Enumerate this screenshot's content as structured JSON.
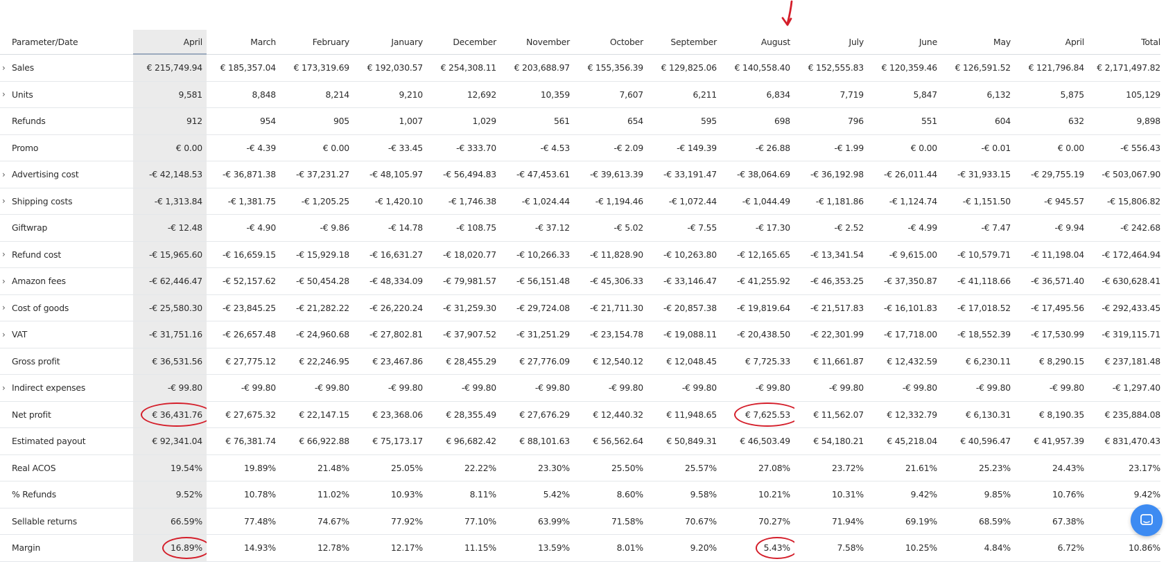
{
  "table": {
    "param_header": "Parameter/Date",
    "columns": [
      "April",
      "March",
      "February",
      "January",
      "December",
      "November",
      "October",
      "September",
      "August",
      "July",
      "June",
      "May",
      "April",
      "Total"
    ],
    "selected_column_index": 0,
    "rows": [
      {
        "label": "Sales",
        "expandable": true,
        "values": [
          "€ 215,749.94",
          "€ 185,357.04",
          "€ 173,319.69",
          "€ 192,030.57",
          "€ 254,308.11",
          "€ 203,688.97",
          "€ 155,356.39",
          "€ 129,825.06",
          "€ 140,558.40",
          "€ 152,555.83",
          "€ 120,359.46",
          "€ 126,591.52",
          "€ 121,796.84",
          "€ 2,171,497.82"
        ]
      },
      {
        "label": "Units",
        "expandable": true,
        "values": [
          "9,581",
          "8,848",
          "8,214",
          "9,210",
          "12,692",
          "10,359",
          "7,607",
          "6,211",
          "6,834",
          "7,719",
          "5,847",
          "6,132",
          "5,875",
          "105,129"
        ]
      },
      {
        "label": "Refunds",
        "expandable": false,
        "values": [
          "912",
          "954",
          "905",
          "1,007",
          "1,029",
          "561",
          "654",
          "595",
          "698",
          "796",
          "551",
          "604",
          "632",
          "9,898"
        ]
      },
      {
        "label": "Promo",
        "expandable": false,
        "values": [
          "€ 0.00",
          "-€ 4.39",
          "€ 0.00",
          "-€ 33.45",
          "-€ 333.70",
          "-€ 4.53",
          "-€ 2.09",
          "-€ 149.39",
          "-€ 26.88",
          "-€ 1.99",
          "€ 0.00",
          "-€ 0.01",
          "€ 0.00",
          "-€ 556.43"
        ]
      },
      {
        "label": "Advertising cost",
        "expandable": true,
        "values": [
          "-€ 42,148.53",
          "-€ 36,871.38",
          "-€ 37,231.27",
          "-€ 48,105.97",
          "-€ 56,494.83",
          "-€ 47,453.61",
          "-€ 39,613.39",
          "-€ 33,191.47",
          "-€ 38,064.69",
          "-€ 36,192.98",
          "-€ 26,011.44",
          "-€ 31,933.15",
          "-€ 29,755.19",
          "-€ 503,067.90"
        ]
      },
      {
        "label": "Shipping costs",
        "expandable": true,
        "values": [
          "-€ 1,313.84",
          "-€ 1,381.75",
          "-€ 1,205.25",
          "-€ 1,420.10",
          "-€ 1,746.38",
          "-€ 1,024.44",
          "-€ 1,194.46",
          "-€ 1,072.44",
          "-€ 1,044.49",
          "-€ 1,181.86",
          "-€ 1,124.74",
          "-€ 1,151.50",
          "-€ 945.57",
          "-€ 15,806.82"
        ]
      },
      {
        "label": "Giftwrap",
        "expandable": false,
        "values": [
          "-€ 12.48",
          "-€ 4.90",
          "-€ 9.86",
          "-€ 14.78",
          "-€ 108.75",
          "-€ 37.12",
          "-€ 5.02",
          "-€ 7.55",
          "-€ 17.30",
          "-€ 2.52",
          "-€ 4.99",
          "-€ 7.47",
          "-€ 9.94",
          "-€ 242.68"
        ]
      },
      {
        "label": "Refund cost",
        "expandable": true,
        "values": [
          "-€ 15,965.60",
          "-€ 16,659.15",
          "-€ 15,929.18",
          "-€ 16,631.27",
          "-€ 18,020.77",
          "-€ 10,266.33",
          "-€ 11,828.90",
          "-€ 10,263.80",
          "-€ 12,165.65",
          "-€ 13,341.54",
          "-€ 9,615.00",
          "-€ 10,579.71",
          "-€ 11,198.04",
          "-€ 172,464.94"
        ]
      },
      {
        "label": "Amazon fees",
        "expandable": true,
        "values": [
          "-€ 62,446.47",
          "-€ 52,157.62",
          "-€ 50,454.28",
          "-€ 48,334.09",
          "-€ 79,981.57",
          "-€ 56,151.48",
          "-€ 45,306.33",
          "-€ 33,146.47",
          "-€ 41,255.92",
          "-€ 46,353.25",
          "-€ 37,350.87",
          "-€ 41,118.66",
          "-€ 36,571.40",
          "-€ 630,628.41"
        ]
      },
      {
        "label": "Cost of goods",
        "expandable": true,
        "values": [
          "-€ 25,580.30",
          "-€ 23,845.25",
          "-€ 21,282.22",
          "-€ 26,220.24",
          "-€ 31,259.30",
          "-€ 29,724.08",
          "-€ 21,711.30",
          "-€ 20,857.38",
          "-€ 19,819.64",
          "-€ 21,517.83",
          "-€ 16,101.83",
          "-€ 17,018.52",
          "-€ 17,495.56",
          "-€ 292,433.45"
        ]
      },
      {
        "label": "VAT",
        "expandable": true,
        "values": [
          "-€ 31,751.16",
          "-€ 26,657.48",
          "-€ 24,960.68",
          "-€ 27,802.81",
          "-€ 37,907.52",
          "-€ 31,251.29",
          "-€ 23,154.78",
          "-€ 19,088.11",
          "-€ 20,438.50",
          "-€ 22,301.99",
          "-€ 17,718.00",
          "-€ 18,552.39",
          "-€ 17,530.99",
          "-€ 319,115.71"
        ]
      },
      {
        "label": "Gross profit",
        "expandable": false,
        "values": [
          "€ 36,531.56",
          "€ 27,775.12",
          "€ 22,246.95",
          "€ 23,467.86",
          "€ 28,455.29",
          "€ 27,776.09",
          "€ 12,540.12",
          "€ 12,048.45",
          "€ 7,725.33",
          "€ 11,661.87",
          "€ 12,432.59",
          "€ 6,230.11",
          "€ 8,290.15",
          "€ 237,181.48"
        ]
      },
      {
        "label": "Indirect expenses",
        "expandable": true,
        "values": [
          "-€ 99.80",
          "-€ 99.80",
          "-€ 99.80",
          "-€ 99.80",
          "-€ 99.80",
          "-€ 99.80",
          "-€ 99.80",
          "-€ 99.80",
          "-€ 99.80",
          "-€ 99.80",
          "-€ 99.80",
          "-€ 99.80",
          "-€ 99.80",
          "-€ 1,297.40"
        ]
      },
      {
        "label": "Net profit",
        "expandable": false,
        "values": [
          "€ 36,431.76",
          "€ 27,675.32",
          "€ 22,147.15",
          "€ 23,368.06",
          "€ 28,355.49",
          "€ 27,676.29",
          "€ 12,440.32",
          "€ 11,948.65",
          "€ 7,625.53",
          "€ 11,562.07",
          "€ 12,332.79",
          "€ 6,130.31",
          "€ 8,190.35",
          "€ 235,884.08"
        ]
      },
      {
        "label": "Estimated payout",
        "expandable": false,
        "values": [
          "€ 92,341.04",
          "€ 76,381.74",
          "€ 66,922.88",
          "€ 75,173.17",
          "€ 96,682.42",
          "€ 88,101.63",
          "€ 56,562.64",
          "€ 50,849.31",
          "€ 46,503.49",
          "€ 54,180.21",
          "€ 45,218.04",
          "€ 40,596.47",
          "€ 41,957.39",
          "€ 831,470.43"
        ]
      },
      {
        "label": "Real ACOS",
        "expandable": false,
        "values": [
          "19.54%",
          "19.89%",
          "21.48%",
          "25.05%",
          "22.22%",
          "23.30%",
          "25.50%",
          "25.57%",
          "27.08%",
          "23.72%",
          "21.61%",
          "25.23%",
          "24.43%",
          "23.17%"
        ]
      },
      {
        "label": "% Refunds",
        "expandable": false,
        "values": [
          "9.52%",
          "10.78%",
          "11.02%",
          "10.93%",
          "8.11%",
          "5.42%",
          "8.60%",
          "9.58%",
          "10.21%",
          "10.31%",
          "9.42%",
          "9.85%",
          "10.76%",
          "9.42%"
        ]
      },
      {
        "label": "Sellable returns",
        "expandable": false,
        "values": [
          "66.59%",
          "77.48%",
          "74.67%",
          "77.92%",
          "77.10%",
          "63.99%",
          "71.58%",
          "70.67%",
          "70.27%",
          "71.94%",
          "69.19%",
          "68.59%",
          "67.38%",
          ""
        ]
      },
      {
        "label": "Margin",
        "expandable": false,
        "values": [
          "16.89%",
          "14.93%",
          "12.78%",
          "12.17%",
          "11.15%",
          "13.59%",
          "8.01%",
          "9.20%",
          "5.43%",
          "7.58%",
          "10.25%",
          "4.84%",
          "6.72%",
          "10.86%"
        ]
      }
    ]
  },
  "annotations": {
    "color": "#d41e2a",
    "circled_cells": [
      {
        "row": 13,
        "col": 0
      },
      {
        "row": 13,
        "col": 8
      },
      {
        "row": 18,
        "col": 0
      },
      {
        "row": 18,
        "col": 8
      }
    ],
    "arrow_column": 8
  },
  "icons": {
    "expand": "chevron-right-icon",
    "chat": "chat-icon"
  },
  "colors": {
    "selected_column_bg": "#ebebeb",
    "chat_button": "#3d8bf2"
  }
}
